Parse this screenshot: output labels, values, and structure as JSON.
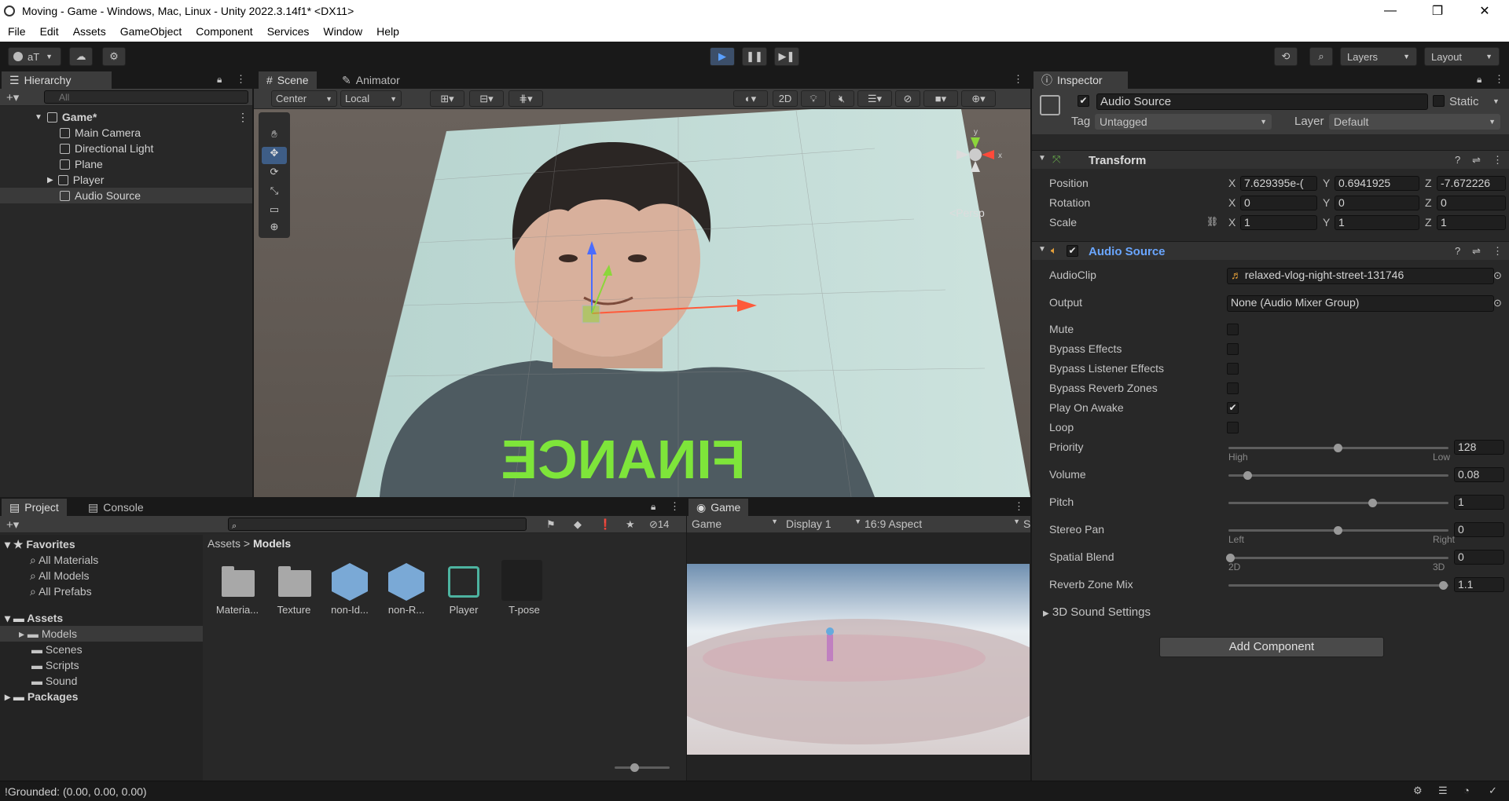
{
  "window": {
    "title": "Moving - Game - Windows, Mac, Linux - Unity 2022.3.14f1* <DX11>",
    "controls": [
      "—",
      "❐",
      "✕"
    ]
  },
  "menu": [
    "File",
    "Edit",
    "Assets",
    "GameObject",
    "Component",
    "Services",
    "Window",
    "Help"
  ],
  "toolbar": {
    "account": "aT",
    "layers": "Layers",
    "layout": "Layout"
  },
  "hierarchy": {
    "tab": "Hierarchy",
    "search_placeholder": "All",
    "scene": "Game*",
    "items": [
      "Main Camera",
      "Directional Light",
      "Plane",
      "Player",
      "Audio Source"
    ]
  },
  "scene_view": {
    "tabs": [
      "Scene",
      "Animator"
    ],
    "pivot": "Center",
    "space": "Local",
    "mode_2d": "2D",
    "persp": "Persp",
    "gizmo_axes": [
      "y",
      "x",
      "z"
    ],
    "shirt_text": "FINANCE"
  },
  "project": {
    "tabs": [
      "Project",
      "Console"
    ],
    "hidden_count": "14",
    "favorites_label": "Favorites",
    "favorites": [
      "All Materials",
      "All Models",
      "All Prefabs"
    ],
    "assets_label": "Assets",
    "asset_folders": [
      "Models",
      "Scenes",
      "Scripts",
      "Sound"
    ],
    "packages_label": "Packages",
    "breadcrumb": [
      "Assets",
      "Models"
    ],
    "items": [
      "Materia...",
      "Texture",
      "non-Id...",
      "non-R...",
      "Player",
      "T-pose"
    ]
  },
  "game_view": {
    "tab": "Game",
    "mode": "Game",
    "display": "Display 1",
    "aspect": "16:9 Aspect",
    "overflow": "S"
  },
  "inspector": {
    "tab": "Inspector",
    "object_name": "Audio Source",
    "static_label": "Static",
    "tag_label": "Tag",
    "tag_value": "Untagged",
    "layer_label": "Layer",
    "layer_value": "Default",
    "transform": {
      "title": "Transform",
      "position_label": "Position",
      "rotation_label": "Rotation",
      "scale_label": "Scale",
      "position": {
        "x": "7.629395e-(",
        "y": "0.6941925",
        "z": "-7.672226"
      },
      "rotation": {
        "x": "0",
        "y": "0",
        "z": "0"
      },
      "scale": {
        "x": "1",
        "y": "1",
        "z": "1"
      }
    },
    "audio": {
      "title": "Audio Source",
      "audioclip_label": "AudioClip",
      "audioclip_value": "relaxed-vlog-night-street-131746",
      "output_label": "Output",
      "output_value": "None (Audio Mixer Group)",
      "toggles": [
        {
          "label": "Mute",
          "checked": false
        },
        {
          "label": "Bypass Effects",
          "checked": false
        },
        {
          "label": "Bypass Listener Effects",
          "checked": false
        },
        {
          "label": "Bypass Reverb Zones",
          "checked": false
        },
        {
          "label": "Play On Awake",
          "checked": true
        },
        {
          "label": "Loop",
          "checked": false
        }
      ],
      "sliders": [
        {
          "label": "Priority",
          "value": "128",
          "fraction": 0.5,
          "min_label": "High",
          "max_label": "Low"
        },
        {
          "label": "Volume",
          "value": "0.08",
          "fraction": 0.08
        },
        {
          "label": "Pitch",
          "value": "1",
          "fraction": 0.66
        },
        {
          "label": "Stereo Pan",
          "value": "0",
          "fraction": 0.5,
          "min_label": "Left",
          "max_label": "Right"
        },
        {
          "label": "Spatial Blend",
          "value": "0",
          "fraction": 0.0,
          "min_label": "2D",
          "max_label": "3D"
        },
        {
          "label": "Reverb Zone Mix",
          "value": "1.1",
          "fraction": 0.99
        }
      ],
      "sound_settings": "3D Sound Settings"
    },
    "add_component": "Add Component"
  },
  "status": {
    "message": "!Grounded: (0.00, 0.00, 0.00)"
  }
}
